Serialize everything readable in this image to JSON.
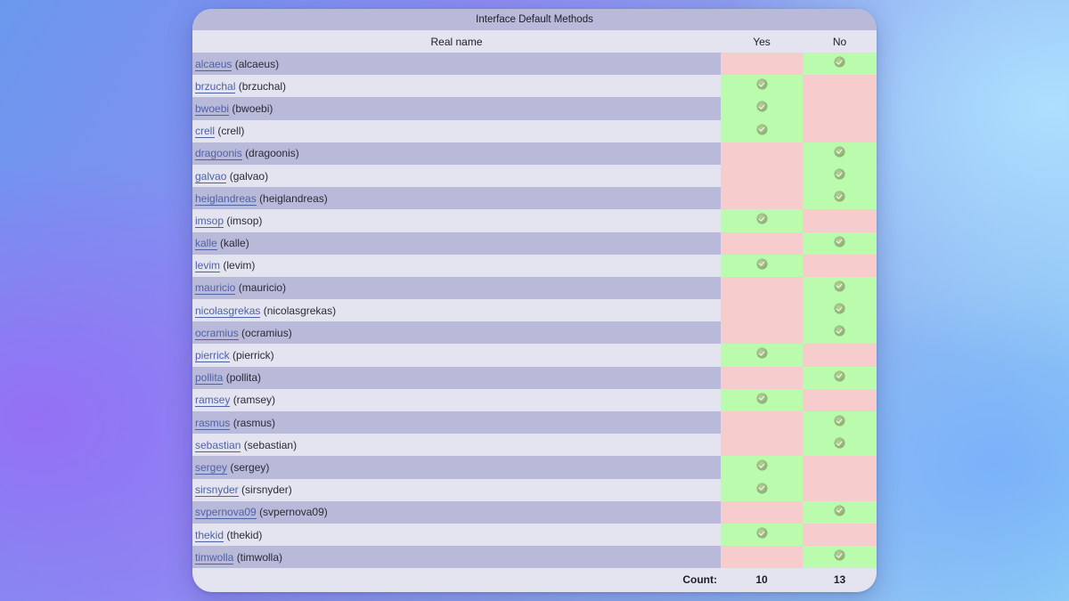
{
  "title": "Interface Default Methods",
  "columns": {
    "name": "Real name",
    "yes": "Yes",
    "no": "No"
  },
  "rows": [
    {
      "username": "alcaeus",
      "realname": "(alcaeus)",
      "vote": "no"
    },
    {
      "username": "brzuchal",
      "realname": "(brzuchal)",
      "vote": "yes"
    },
    {
      "username": "bwoebi",
      "realname": "(bwoebi)",
      "vote": "yes"
    },
    {
      "username": "crell",
      "realname": "(crell)",
      "vote": "yes"
    },
    {
      "username": "dragoonis",
      "realname": "(dragoonis)",
      "vote": "no"
    },
    {
      "username": "galvao",
      "realname": "(galvao)",
      "vote": "no"
    },
    {
      "username": "heiglandreas",
      "realname": "(heiglandreas)",
      "vote": "no"
    },
    {
      "username": "imsop",
      "realname": "(imsop)",
      "vote": "yes"
    },
    {
      "username": "kalle",
      "realname": "(kalle)",
      "vote": "no"
    },
    {
      "username": "levim",
      "realname": "(levim)",
      "vote": "yes"
    },
    {
      "username": "mauricio",
      "realname": "(mauricio)",
      "vote": "no"
    },
    {
      "username": "nicolasgrekas",
      "realname": "(nicolasgrekas)",
      "vote": "no"
    },
    {
      "username": "ocramius",
      "realname": "(ocramius)",
      "vote": "no"
    },
    {
      "username": "pierrick",
      "realname": "(pierrick)",
      "vote": "yes"
    },
    {
      "username": "pollita",
      "realname": "(pollita)",
      "vote": "no"
    },
    {
      "username": "ramsey",
      "realname": "(ramsey)",
      "vote": "yes"
    },
    {
      "username": "rasmus",
      "realname": "(rasmus)",
      "vote": "no"
    },
    {
      "username": "sebastian",
      "realname": "(sebastian)",
      "vote": "no"
    },
    {
      "username": "sergey",
      "realname": "(sergey)",
      "vote": "yes"
    },
    {
      "username": "sirsnyder",
      "realname": "(sirsnyder)",
      "vote": "yes"
    },
    {
      "username": "svpernova09",
      "realname": "(svpernova09)",
      "vote": "no"
    },
    {
      "username": "thekid",
      "realname": "(thekid)",
      "vote": "yes"
    },
    {
      "username": "timwolla",
      "realname": "(timwolla)",
      "vote": "no"
    }
  ],
  "footer": {
    "label": "Count:",
    "yes_count": "10",
    "no_count": "13"
  },
  "colors": {
    "selected_cell": "#bbfbad",
    "unselected_cell": "#f7cccd",
    "row_odd": "#b9b9d9",
    "row_even": "#e3e4ef",
    "link": "#4f62a4"
  },
  "icons": {
    "vote_mark": "check-circle-icon"
  }
}
